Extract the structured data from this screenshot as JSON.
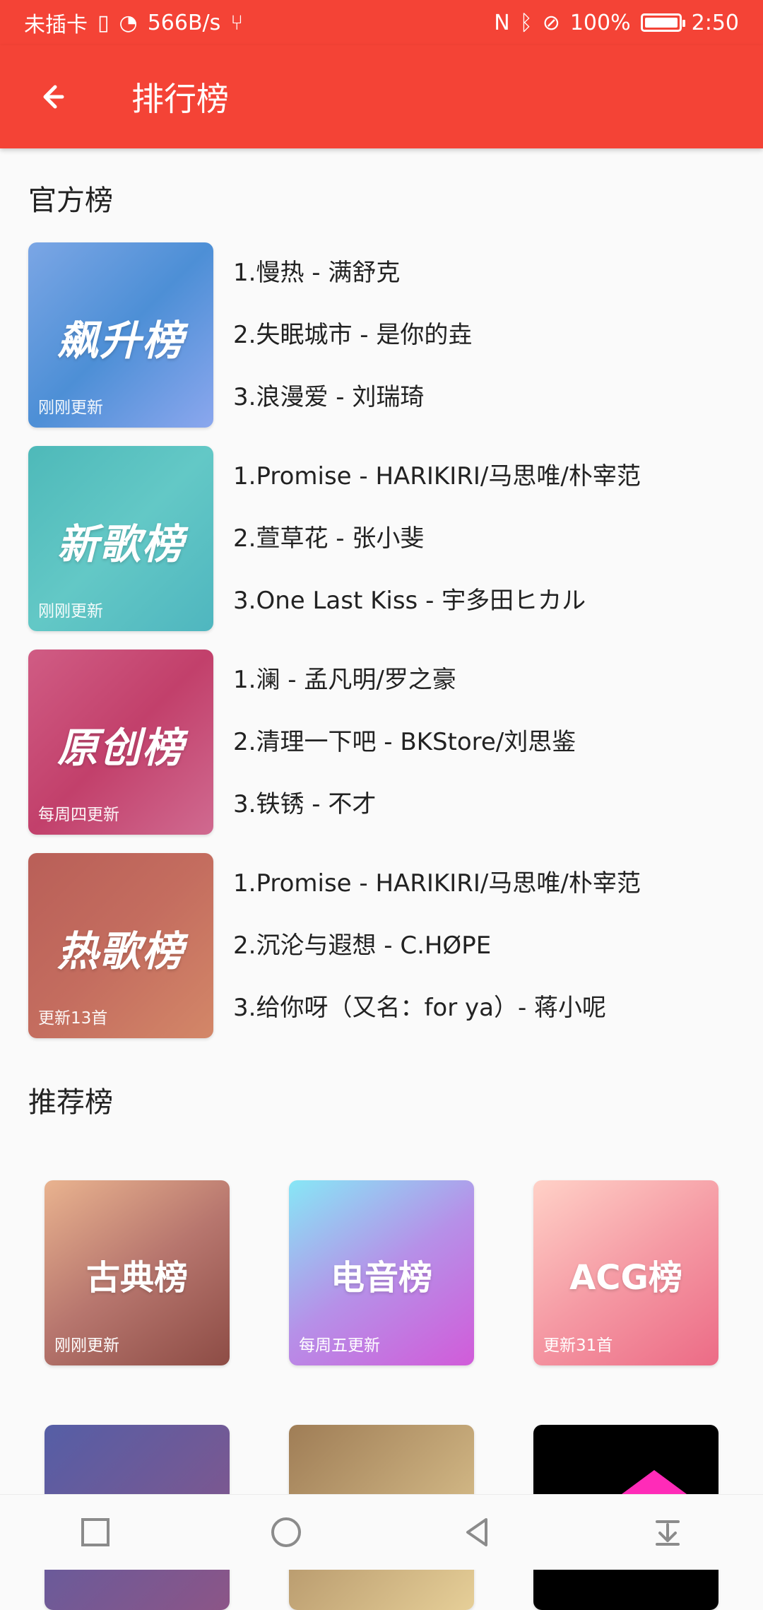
{
  "status_bar": {
    "carrier": "未插卡",
    "network_speed": "566B/s",
    "battery": "100%",
    "time": "2:50"
  },
  "app_bar": {
    "title": "排行榜"
  },
  "sections": {
    "official": {
      "title": "官方榜",
      "charts": [
        {
          "name": "飙升榜",
          "note": "刚刚更新",
          "tracks": [
            "1.慢热 - 满舒克",
            "2.失眠城市 - 是你的垚",
            "3.浪漫爱 - 刘瑞琦"
          ],
          "gradient": [
            "#7ba6e5",
            "#4d8fd6",
            "#8ba7ee"
          ]
        },
        {
          "name": "新歌榜",
          "note": "刚刚更新",
          "tracks": [
            "1.Promise - HARIKIRI/马思唯/朴宰范",
            "2.萱草花 - 张小斐",
            "3.One Last Kiss - 宇多田ヒカル"
          ],
          "gradient": [
            "#4eb9b9",
            "#63c8c6",
            "#4fb6bf"
          ]
        },
        {
          "name": "原创榜",
          "note": "每周四更新",
          "tracks": [
            "1.澜 - 孟凡明/罗之豪",
            "2.清理一下吧 - BKStore/刘思鉴",
            "3.铁锈 - 不才"
          ],
          "gradient": [
            "#d05c84",
            "#c2406b",
            "#d06a90"
          ]
        },
        {
          "name": "热歌榜",
          "note": "更新13首",
          "tracks": [
            "1.Promise - HARIKIRI/马思唯/朴宰范",
            "2.沉沦与遐想 - C.HØPE",
            "3.给你呀（又名：for ya）- 蒋小呢"
          ],
          "gradient": [
            "#b95f58",
            "#c46d5f",
            "#d38768"
          ]
        }
      ]
    },
    "recommended": {
      "title": "推荐榜",
      "charts": [
        {
          "name": "古典榜",
          "note": "刚刚更新",
          "gradient": [
            "#e9b38f",
            "#b7766e",
            "#8d4c45"
          ]
        },
        {
          "name": "电音榜",
          "note": "每周五更新",
          "gradient": [
            "#87e7f6",
            "#b690e8",
            "#d15bd9"
          ]
        },
        {
          "name": "ACG榜",
          "note": "更新31首",
          "gradient": [
            "#ffd1c7",
            "#f59aa4",
            "#ec6b86"
          ]
        }
      ]
    }
  },
  "icons": {
    "back": "arrow-left-icon",
    "nav": [
      "square-icon",
      "circle-icon",
      "triangle-back-icon",
      "download-icon"
    ],
    "status": [
      "sim-icon",
      "wifi-icon",
      "usb-icon",
      "nfc-icon",
      "bluetooth-icon",
      "mute-icon",
      "battery-icon"
    ]
  },
  "colors": {
    "accent": "#f44336",
    "background": "#fafafa",
    "text": "#222222"
  }
}
